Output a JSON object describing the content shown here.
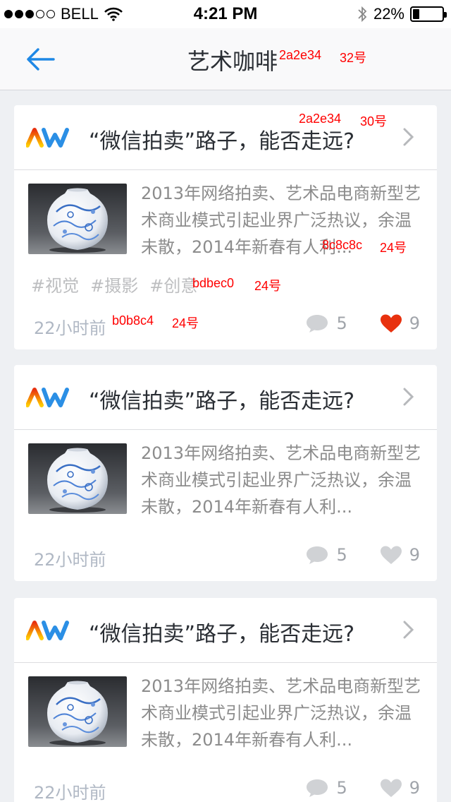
{
  "status_bar": {
    "carrier": "BELL",
    "time": "4:21 PM",
    "battery_percent": "22%",
    "battery_level": 0.22,
    "signal_bars_filled": 3,
    "signal_bars_total": 5
  },
  "nav": {
    "title": "艺术咖啡",
    "back_icon": "arrow-left-icon",
    "title_annotation_color": "2a2e34",
    "title_annotation_size": "32号"
  },
  "annotations": {
    "title_color": "2a2e34",
    "title_size": "30号",
    "summary_color": "8c8c8c",
    "summary_size": "24号",
    "tag_color": "bdbec0",
    "tag_size": "24号",
    "time_color": "b0b8c4",
    "time_size": "24号"
  },
  "colors": {
    "accent": "#1e88e5",
    "title": "#2a2e34",
    "summary": "#8c8c8c",
    "tags": "#bdbec0",
    "time": "#b0b8c4",
    "like_active": "#e8310e",
    "like_inactive": "#d0d2d5"
  },
  "cards": [
    {
      "title": "“微信拍卖”路子，能否走远?",
      "summary": "2013年网络拍卖、艺术品电商新型艺术商业模式引起业界广泛热议，余温未散，2014年新春有人利...",
      "tags": [
        "#视觉",
        "#摄影",
        "#创意"
      ],
      "time": "22小时前",
      "comments": "5",
      "likes": "9",
      "liked": true
    },
    {
      "title": "“微信拍卖”路子，能否走远?",
      "summary": "2013年网络拍卖、艺术品电商新型艺术商业模式引起业界广泛热议，余温未散，2014年新春有人利...",
      "tags": [],
      "time": "22小时前",
      "comments": "5",
      "likes": "9",
      "liked": false
    },
    {
      "title": "“微信拍卖”路子，能否走远?",
      "summary": "2013年网络拍卖、艺术品电商新型艺术商业模式引起业界广泛热议，余温未散，2014年新春有人利...",
      "tags": [],
      "time": "22小时前",
      "comments": "5",
      "likes": "9",
      "liked": false
    }
  ]
}
